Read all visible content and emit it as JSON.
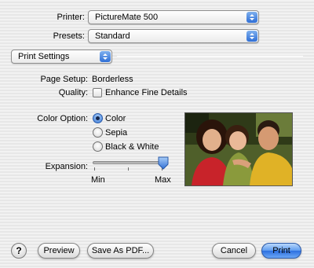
{
  "printer": {
    "label": "Printer:",
    "value": "PictureMate 500"
  },
  "presets": {
    "label": "Presets:",
    "value": "Standard"
  },
  "panel": {
    "value": "Print Settings"
  },
  "page_setup": {
    "label": "Page Setup:",
    "value": "Borderless"
  },
  "quality": {
    "label": "Quality:",
    "checkbox_label": "Enhance Fine Details",
    "checked": false
  },
  "color_option": {
    "label": "Color Option:",
    "options": [
      "Color",
      "Sepia",
      "Black & White"
    ],
    "selected": "Color"
  },
  "expansion": {
    "label": "Expansion:",
    "min_label": "Min",
    "max_label": "Max",
    "level": 1.0
  },
  "buttons": {
    "help": "?",
    "preview": "Preview",
    "save_pdf": "Save As PDF...",
    "cancel": "Cancel",
    "print": "Print"
  },
  "colors": {
    "accent": "#3a7ad8",
    "default_button": "#5d9bef"
  }
}
